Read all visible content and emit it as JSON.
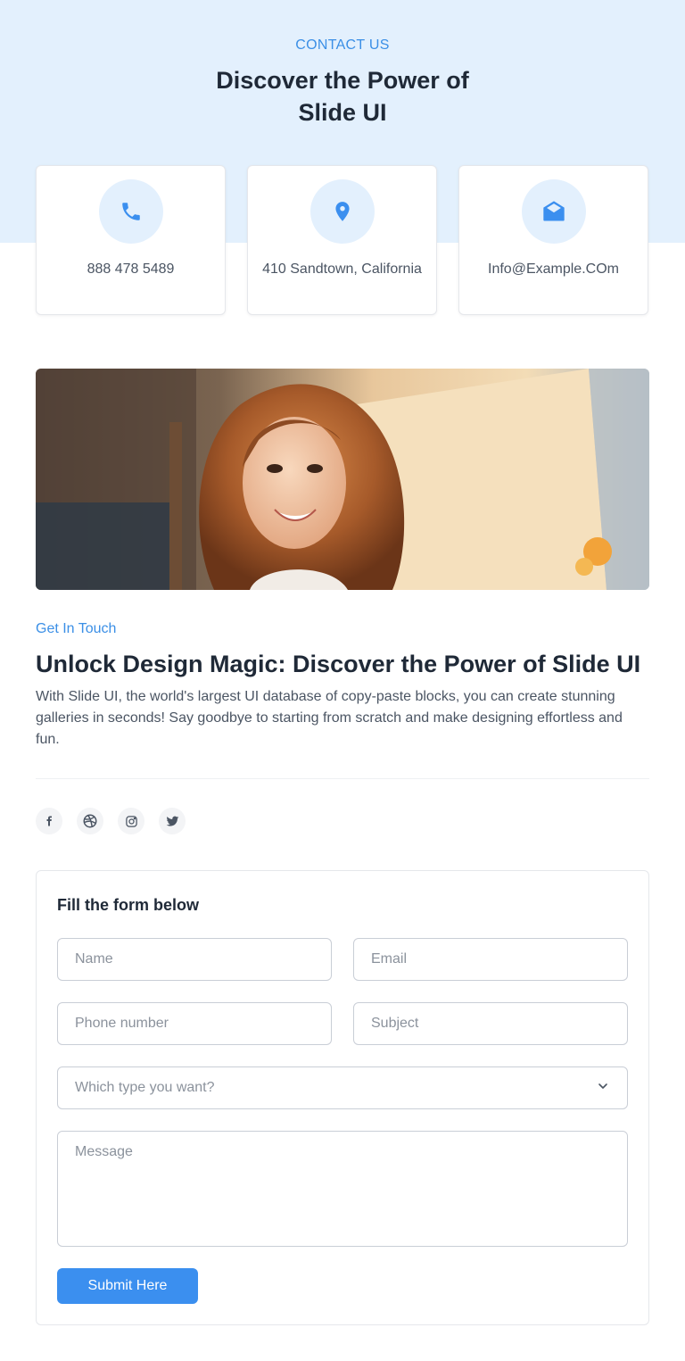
{
  "header": {
    "eyebrow": "CONTACT US",
    "title": "Discover the Power of Slide UI"
  },
  "contact_cards": [
    {
      "icon": "phone-icon",
      "text": "888 478 5489"
    },
    {
      "icon": "location-pin-icon",
      "text": "410 Sandtown, California"
    },
    {
      "icon": "mail-icon",
      "text": "Info@Example.COm"
    }
  ],
  "image": {
    "subject": "smiling-woman-illustration"
  },
  "touch": {
    "label": "Get In Touch",
    "title": "Unlock Design Magic: Discover the Power of Slide UI",
    "description": "With Slide UI, the world's largest UI database of copy-paste blocks, you can create stunning galleries in seconds! Say goodbye to starting from scratch and make designing effortless and fun."
  },
  "social": [
    "facebook-icon",
    "dribbble-icon",
    "instagram-icon",
    "twitter-icon"
  ],
  "form": {
    "title": "Fill the form below",
    "name_placeholder": "Name",
    "email_placeholder": "Email",
    "phone_placeholder": "Phone number",
    "subject_placeholder": "Subject",
    "type_placeholder": "Which type you want?",
    "message_placeholder": "Message",
    "submit_label": "Submit Here"
  },
  "colors": {
    "accent": "#3b8fef",
    "hero_background": "#e3f0fd",
    "text_dark": "#1f2937",
    "text_muted": "#4b5563"
  }
}
